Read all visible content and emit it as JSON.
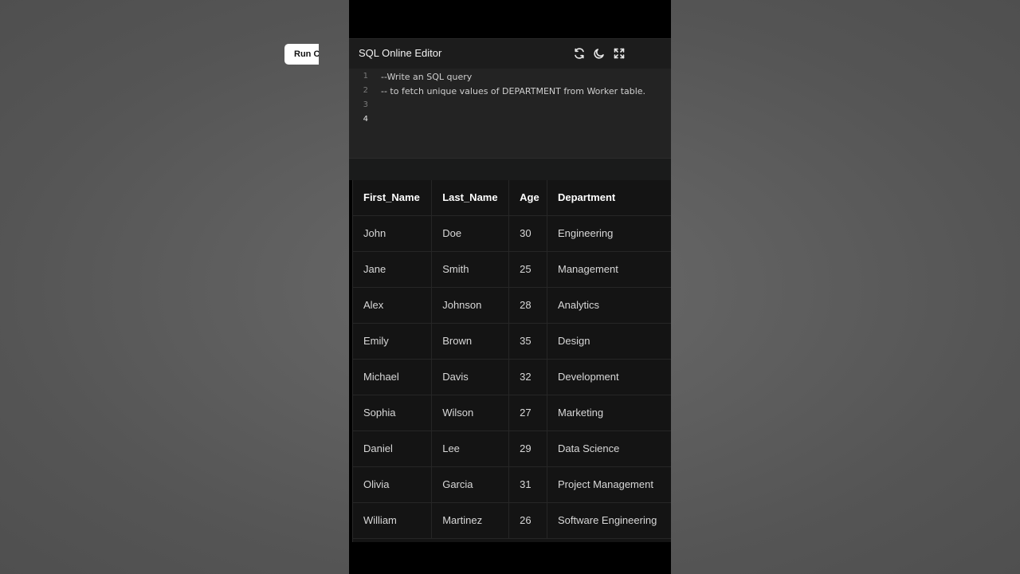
{
  "editor": {
    "title": "SQL Online Editor",
    "icons": [
      "refresh-icon",
      "moon-icon",
      "fullscreen-icon"
    ],
    "run_label": "Run Code",
    "lines": [
      {
        "num": "1",
        "text": "--Write an SQL query"
      },
      {
        "num": "2",
        "text": "-- to fetch unique values of DEPARTMENT from Worker table."
      },
      {
        "num": "3",
        "text": ""
      },
      {
        "num": "4",
        "text": ""
      }
    ]
  },
  "table": {
    "headers": [
      "First_Name",
      "Last_Name",
      "Age",
      "Department"
    ],
    "rows": [
      [
        "John",
        "Doe",
        "30",
        "Engineering"
      ],
      [
        "Jane",
        "Smith",
        "25",
        "Management"
      ],
      [
        "Alex",
        "Johnson",
        "28",
        "Analytics"
      ],
      [
        "Emily",
        "Brown",
        "35",
        "Design"
      ],
      [
        "Michael",
        "Davis",
        "32",
        "Development"
      ],
      [
        "Sophia",
        "Wilson",
        "27",
        "Marketing"
      ],
      [
        "Daniel",
        "Lee",
        "29",
        "Data Science"
      ],
      [
        "Olivia",
        "Garcia",
        "31",
        "Project Management"
      ],
      [
        "William",
        "Martinez",
        "26",
        "Software Engineering"
      ]
    ]
  },
  "colors": {
    "background": "#5a5a5a",
    "panel": "#141414",
    "header": "#1c1c1c",
    "run_button": "#ffffff"
  }
}
